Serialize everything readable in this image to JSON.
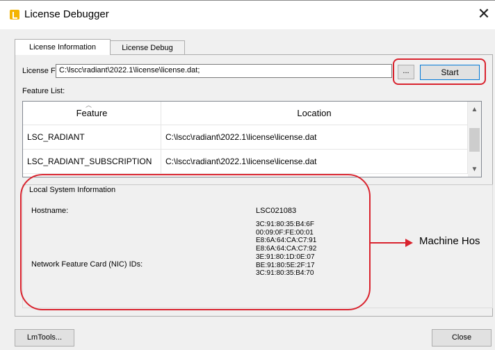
{
  "window": {
    "title": "License Debugger",
    "close_glyph": "✕"
  },
  "tabs": [
    {
      "label": "License Information",
      "active": true
    },
    {
      "label": "License Debug",
      "active": false
    }
  ],
  "license_file": {
    "label": "License File:",
    "value": "C:\\lscc\\radiant\\2022.1\\license\\license.dat;",
    "browse_label": "...",
    "start_label": "Start"
  },
  "feature_list": {
    "label": "Feature List:",
    "columns": [
      "Feature",
      "Location"
    ],
    "rows": [
      {
        "feature": "LSC_RADIANT",
        "location": "C:\\lscc\\radiant\\2022.1\\license\\license.dat"
      },
      {
        "feature": "LSC_RADIANT_SUBSCRIPTION",
        "location": "C:\\lscc\\radiant\\2022.1\\license\\license.dat"
      }
    ]
  },
  "local_system": {
    "group_label": "Local System Information",
    "hostname_label": "Hostname:",
    "hostname_value": "LSC021083",
    "nic_label": "Network Feature Card (NIC) IDs:",
    "nic_ids": [
      "3C:91:80:35:B4:6F",
      "00:09:0F:FE:00:01",
      "E8:6A:64:CA:C7:91",
      "E8:6A:64:CA:C7:92",
      "3E:91:80:1D:0E:07",
      "BE:91:80:5E:2F:17",
      "3C:91:80:35:B4:70"
    ]
  },
  "annotation": {
    "text": "Machine Hos"
  },
  "footer": {
    "lmtools_label": "LmTools...",
    "close_label": "Close"
  },
  "colors": {
    "annotation_red": "#d9232e",
    "start_border": "#0078d7",
    "app_icon": "#f4b400"
  }
}
